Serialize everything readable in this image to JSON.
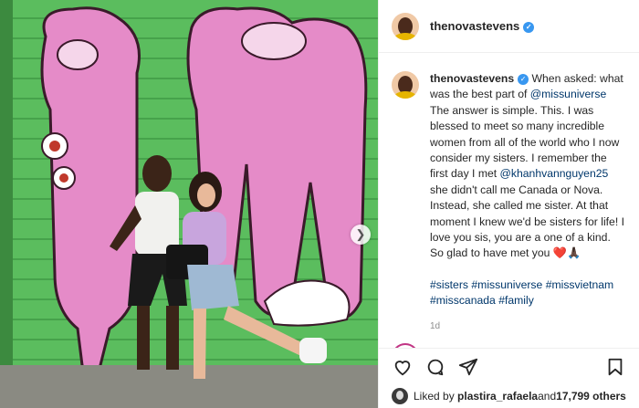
{
  "header": {
    "username": "thenovastevens",
    "verified_icon": "verified-badge-icon"
  },
  "caption": {
    "username": "thenovastevens",
    "seg1": " When asked: what was the best part of ",
    "mention1": "@missuniverse",
    "seg2": " The answer is simple. This. I was blessed to meet so many incredible women from all of the world who I now consider my sisters. I remember the first day I met ",
    "mention2": "@khanhvannguyen25",
    "seg3": " she didn't call me Canada or Nova. Instead, she called me sister. At that moment I knew we'd be sisters for life! I love you sis, you are a one of a kind. So glad to have met you ",
    "emoji": "❤️🙏🏿",
    "tags": [
      "#sisters",
      "#missuniverse",
      "#missvietnam",
      "#misscanada",
      "#family"
    ]
  },
  "time": "1d",
  "likes": {
    "prefix": "Liked by ",
    "user": "plastira_rafaela",
    "middle": " and ",
    "count": "17,799 others"
  },
  "actions": [
    "heart-icon",
    "comment-icon",
    "share-icon",
    "bookmark-icon"
  ],
  "colors": {
    "link": "#00376b",
    "verified": "#3897f0",
    "wall_green": "#57b85a",
    "graffiti_pink": "#e07fc3"
  }
}
